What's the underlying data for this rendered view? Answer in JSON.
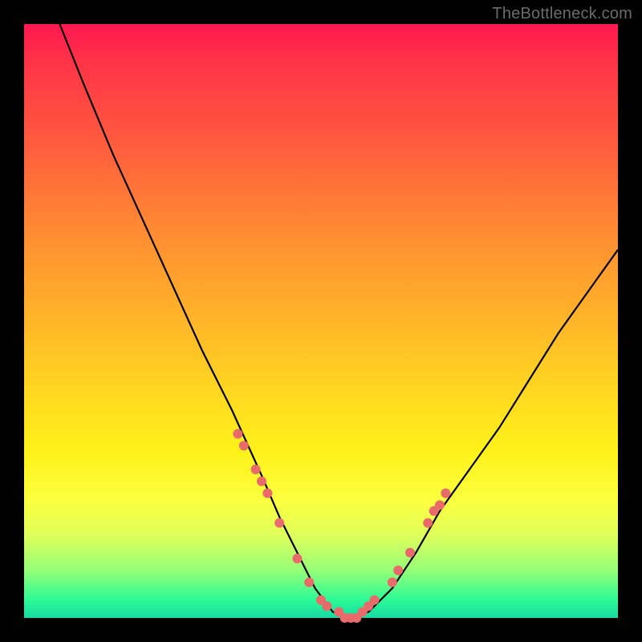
{
  "watermark": "TheBottleneck.com",
  "chart_data": {
    "type": "line",
    "title": "",
    "xlabel": "",
    "ylabel": "",
    "xlim": [
      0,
      100
    ],
    "ylim": [
      0,
      100
    ],
    "series": [
      {
        "name": "bottleneck-curve",
        "x": [
          6,
          10,
          15,
          20,
          25,
          30,
          35,
          40,
          43,
          46,
          49,
          52,
          55,
          58,
          62,
          66,
          70,
          75,
          80,
          85,
          90,
          95,
          100
        ],
        "y": [
          100,
          90,
          78,
          67,
          56,
          45,
          35,
          24,
          17,
          11,
          5,
          1,
          0,
          1,
          5,
          11,
          18,
          25,
          32,
          40,
          48,
          55,
          62
        ]
      }
    ],
    "markers": {
      "name": "sample-points",
      "color": "#e86a6a",
      "x": [
        36,
        37,
        39,
        40,
        41,
        43,
        46,
        48,
        50,
        51,
        53,
        54,
        55,
        56,
        57,
        58,
        59,
        62,
        63,
        65,
        68,
        69,
        70,
        71
      ],
      "y": [
        31,
        29,
        25,
        23,
        21,
        16,
        10,
        6,
        3,
        2,
        1,
        0,
        0,
        0,
        1,
        2,
        3,
        6,
        8,
        11,
        16,
        18,
        19,
        21
      ]
    }
  }
}
